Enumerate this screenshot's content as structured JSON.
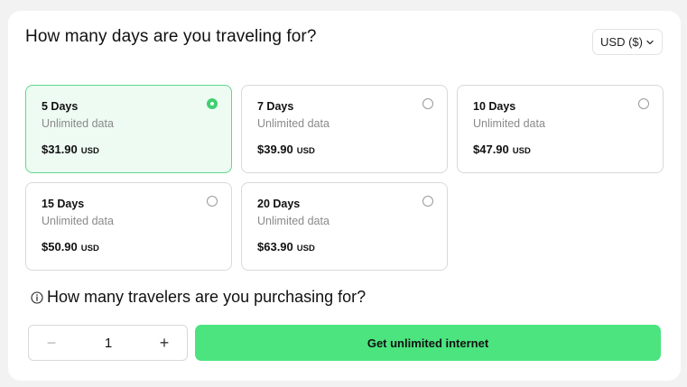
{
  "header": {
    "title": "How many days are you traveling for?",
    "currency_selector": {
      "value": "USD ($)",
      "icon": "chevron-down-icon"
    }
  },
  "plans": [
    {
      "name": "5 Days",
      "description": "Unlimited data",
      "price": "$31.90",
      "currency": "USD",
      "selected": true
    },
    {
      "name": "7 Days",
      "description": "Unlimited data",
      "price": "$39.90",
      "currency": "USD",
      "selected": false
    },
    {
      "name": "10 Days",
      "description": "Unlimited data",
      "price": "$47.90",
      "currency": "USD",
      "selected": false
    },
    {
      "name": "15 Days",
      "description": "Unlimited data",
      "price": "$50.90",
      "currency": "USD",
      "selected": false
    },
    {
      "name": "20 Days",
      "description": "Unlimited data",
      "price": "$63.90",
      "currency": "USD",
      "selected": false
    }
  ],
  "travelers": {
    "question": "How many travelers are you purchasing for?",
    "info_icon": "info-icon",
    "quantity": "1",
    "minus_label": "−",
    "plus_label": "+"
  },
  "cta": {
    "label": "Get unlimited internet"
  },
  "colors": {
    "accent": "#4be47f",
    "selected_border": "#5fd88a",
    "selected_bg": "#eefbf2",
    "radio_selected": "#3fd06f"
  }
}
